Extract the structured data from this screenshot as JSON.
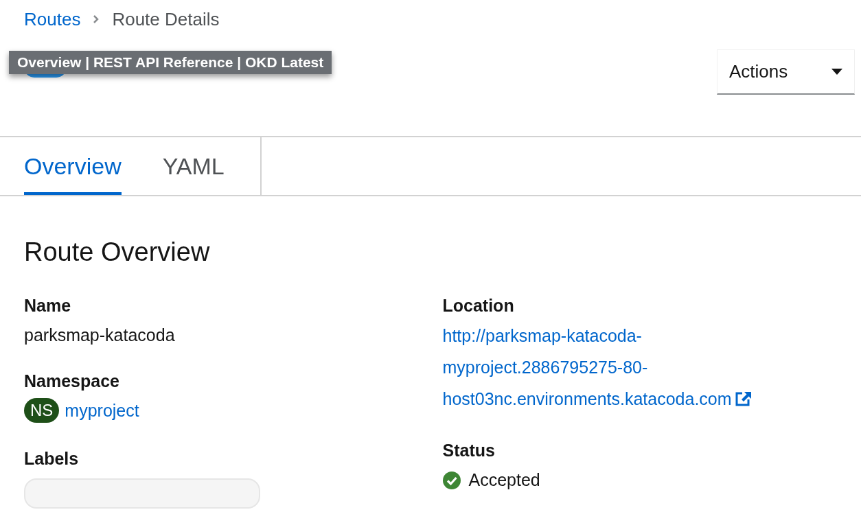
{
  "breadcrumb": [
    {
      "label": "Routes"
    },
    {
      "label": "Route Details"
    }
  ],
  "tooltip": "Overview | REST API Reference | OKD Latest",
  "actions_button": "Actions",
  "tabs": [
    {
      "label": "Overview",
      "selected": true
    },
    {
      "label": "YAML",
      "selected": false
    }
  ],
  "section_title": "Route Overview",
  "left_fields": [
    {
      "label": "Name",
      "kind": "text",
      "value": "parksmap-katacoda"
    },
    {
      "label": "Namespace",
      "kind": "namespace",
      "badge": "NS",
      "value": "myproject"
    },
    {
      "label": "Labels",
      "kind": "labels"
    }
  ],
  "right_fields": [
    {
      "label": "Location",
      "kind": "external-link",
      "value": "http://parksmap-katacoda-myproject.2886795275-80-host03nc.environments.katacoda.com"
    },
    {
      "label": "Status",
      "kind": "status",
      "value": "Accepted",
      "color": "#3e8635"
    }
  ]
}
